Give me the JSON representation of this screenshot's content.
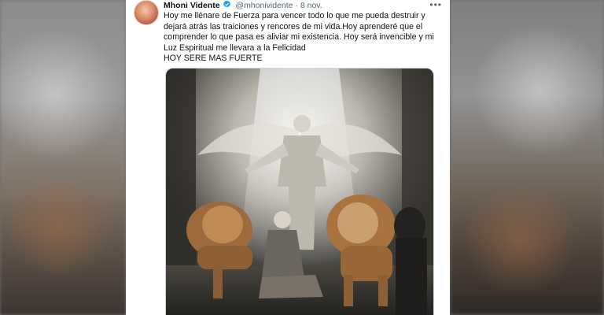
{
  "tweet": {
    "display_name": "Mhoni Vidente",
    "handle": "@mhonividente",
    "separator": "·",
    "date": "8 nov.",
    "more_icon": "more-horizontal-icon",
    "text_lines": [
      "Hoy me llénare de Fuerza para vencer todo lo que me pueda destruir y",
      "dejará atrás las traiciones y rencores de mi vida.Hoy aprenderé que el",
      "comprender lo que pasa es aliviar mi existencia. Hoy será invencible y mi",
      "Luz Espiritual me llevara a la Felicidad",
      "HOY SERE MAS FUERTE"
    ],
    "media": {
      "description_icon": "image",
      "colors": {
        "background": "#3d3b36",
        "light": "#e9e6df",
        "lion": "#b07a45"
      }
    }
  },
  "colors": {
    "verified": "#1d9bf0",
    "text": "#0f1419",
    "secondary": "#536471"
  }
}
